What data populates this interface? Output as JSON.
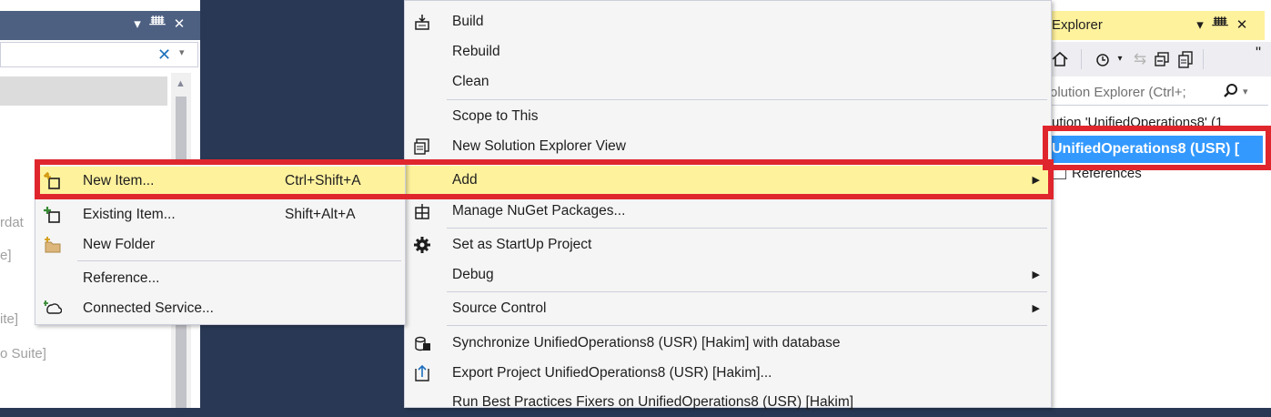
{
  "left_panel": {
    "titlebar_buttons": [
      "▾",
      "ᚙ",
      "✕"
    ],
    "search_clear": "✕",
    "search_dropdown": "▾",
    "scroll_up": "▲",
    "ghost_lines": [
      "rdat",
      "e]",
      "ite]",
      "o Suite]"
    ]
  },
  "solution_explorer": {
    "title": "Explorer",
    "title_buttons": [
      "▾",
      "ᚙ",
      "✕"
    ],
    "toolbar_overflow": "\"",
    "search_placeholder": "olution Explorer (Ctrl+;",
    "search_dropdown": "▾",
    "root_item": "ution 'UnifiedOperations8' (1",
    "project_item": "UnifiedOperations8 (USR) [",
    "references_item": "References"
  },
  "main_menu": {
    "items": [
      {
        "label": "Build",
        "icon": "build-icon"
      },
      {
        "label": "Rebuild"
      },
      {
        "label": "Clean"
      },
      {
        "label": "Scope to This"
      },
      {
        "label": "New Solution Explorer View",
        "icon": "new-view-icon"
      },
      {
        "label": "Add",
        "submenu_arrow": "▶",
        "highlighted": true
      },
      {
        "label": "Manage NuGet Packages...",
        "icon": "nuget-icon"
      },
      {
        "label": "Set as StartUp Project",
        "icon": "gear-icon"
      },
      {
        "label": "Debug",
        "submenu_arrow": "▶"
      },
      {
        "label": "Source Control",
        "submenu_arrow": "▶"
      },
      {
        "label": "Synchronize UnifiedOperations8 (USR) [Hakim] with database",
        "icon": "sync-db-icon"
      },
      {
        "label": "Export Project UnifiedOperations8 (USR) [Hakim]...",
        "icon": "export-icon"
      },
      {
        "label": "Run Best Practices Fixers on UnifiedOperations8 (USR) [Hakim]"
      }
    ]
  },
  "add_submenu": {
    "items": [
      {
        "label": "New Item...",
        "shortcut": "Ctrl+Shift+A",
        "icon": "new-item-icon",
        "highlighted": true
      },
      {
        "label": "Existing Item...",
        "shortcut": "Shift+Alt+A",
        "icon": "existing-item-icon"
      },
      {
        "label": "New Folder",
        "icon": "new-folder-icon"
      },
      {
        "label": "Reference..."
      },
      {
        "label": "Connected Service...",
        "icon": "connected-service-icon"
      }
    ]
  },
  "colors": {
    "background": "#293955",
    "menu_bg": "#f5f5f5",
    "menu_highlight": "#fff29d",
    "selection": "#3399ff",
    "annotation_red": "#e0262d"
  }
}
